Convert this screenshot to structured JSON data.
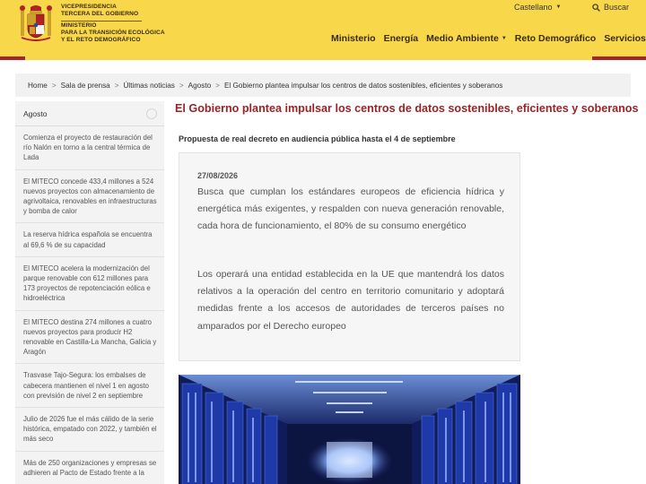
{
  "header": {
    "gov_lines": [
      "VICEPRESIDENCIA",
      "TERCERA DEL GOBIERNO"
    ],
    "ministry_lines": [
      "MINISTERIO",
      "PARA LA TRANSICIÓN ECOLÓGICA",
      "Y EL RETO DEMOGRÁFICO"
    ],
    "language": "Castellano",
    "search_label": "Buscar",
    "nav": [
      "Ministerio",
      "Energía",
      "Medio Ambiente",
      "Reto Demográfico",
      "Servicios"
    ],
    "colors": {
      "background": "#f8d84a",
      "accent": "#a4262c"
    }
  },
  "breadcrumb": [
    "Home",
    "Sala de prensa",
    "Últimas noticias",
    "Agosto",
    "El Gobierno plantea impulsar los centros de datos sostenibles, eficientes y soberanos"
  ],
  "sidebar": {
    "heading": "Agosto",
    "items": [
      "Comienza el proyecto de restauración del río Nalón en torno a la central térmica de Lada",
      "El MITECO concede 433,4 millones a 524 nuevos proyectos con almacenamiento de agrivoltaica, renovables en infraestructuras y bomba de calor",
      "La reserva hídrica española se encuentra al 69,6 % de su capacidad",
      "El MITECO acelera la modernización del parque renovable con 612 millones para 173 proyectos de repotenciación eólica e hidroeléctrica",
      "El MITECO destina 274 millones a cuatro nuevos proyectos para producir H2 renovable en Castilla-La Mancha, Galicia y Aragón",
      "Trasvase Tajo-Segura: los embalses de cabecera mantienen el nivel 1 en agosto con previsión de nivel 2 en septiembre",
      "Julio de 2026 fue el más cálido de la serie histórica, empatado con 2022, y también el más seco",
      "Más de 250 organizaciones y empresas se adhieren al Pacto de Estado frente a la"
    ]
  },
  "article": {
    "title": "El Gobierno plantea impulsar los centros de datos sostenibles, eficientes y soberanos",
    "subtitle": "Propuesta de real decreto en audiencia pública hasta el 4 de septiembre",
    "date": "27/08/2026",
    "paragraphs": [
      "Busca que cumplan los estándares europeos de eficiencia hídrica y energética más exigentes, y respalden con nueva generación renovable, cada hora de funcionamiento, el 80% de su consumo energético",
      "Los operará una entidad establecida en la UE que mantendrá los datos relativos a la operación del centro en territorio comunitario y adoptará medidas frente a los accesos de autoridades de terceros países no amparados por el Derecho europeo"
    ]
  }
}
